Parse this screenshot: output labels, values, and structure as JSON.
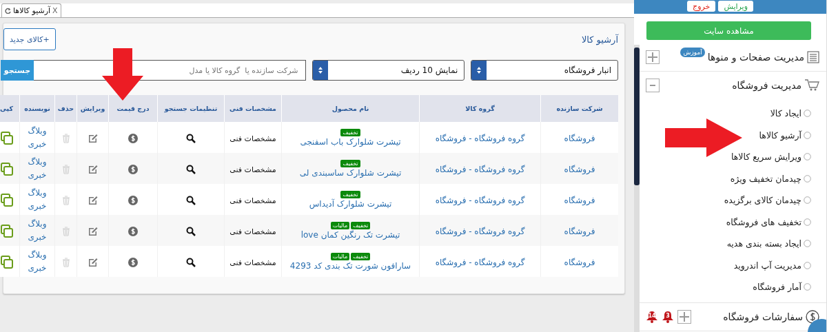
{
  "tab": {
    "title": "آرشیو کالاها",
    "close_label": "X"
  },
  "panel": {
    "title": "آرشیو کالا",
    "new_button": "+کالای جدید",
    "filters": {
      "warehouse": "انبار فروشگاه",
      "page_size": "نمایش 10 ردیف",
      "search_placeholder": "شرکت سازنده یا  گروه کالا یا مدل",
      "search_button": "جستجو"
    },
    "table": {
      "columns": [
        "شرکت سازنده",
        "گروه کالا",
        "نام محصول",
        "مشخصات فنی",
        "تنظیمات جستجو",
        "درج قیمت",
        "ویرایش",
        "حذف",
        "نویسنده",
        "کپی"
      ],
      "rows": [
        {
          "maker": "فروشگاه",
          "group": "گروه فروشگاه - فروشگاه",
          "name": "تیشرت شلوارک باب اسفنجی",
          "tags": [
            "تخفیف"
          ],
          "specs": "مشخصات فنی",
          "author": "وبلاگ خبری"
        },
        {
          "maker": "فروشگاه",
          "group": "گروه فروشگاه - فروشگاه",
          "name": "تیشرت شلوارک ساسبندی لی",
          "tags": [
            "تخفیف"
          ],
          "specs": "مشخصات فنی",
          "author": "وبلاگ خبری"
        },
        {
          "maker": "فروشگاه",
          "group": "گروه فروشگاه - فروشگاه",
          "name": "تیشرت شلوارک آدیداس",
          "tags": [
            "تخفیف"
          ],
          "specs": "مشخصات فنی",
          "author": "وبلاگ خبری"
        },
        {
          "maker": "فروشگاه",
          "group": "گروه فروشگاه - فروشگاه",
          "name": "تیشرت تک رنگین کمان love",
          "tags": [
            "تخفیف",
            "مالیات"
          ],
          "specs": "مشخصات فنی",
          "author": "وبلاگ خبری"
        },
        {
          "maker": "فروشگاه",
          "group": "گروه فروشگاه - فروشگاه",
          "name": "سارافون شورت تک بندی کد 4293",
          "tags": [
            "تخفیف",
            "مالیات"
          ],
          "specs": "مشخصات فنی",
          "author": "وبلاگ خبری"
        }
      ]
    }
  },
  "sidebar": {
    "top_buttons": [
      {
        "label": "ویرایش",
        "kind": "edit"
      },
      {
        "label": "خروج",
        "kind": "exit"
      }
    ],
    "view_site_button": "مشاهده سایت",
    "menu": [
      {
        "label": "مدیریت صفحات و منوها",
        "kind": "pages",
        "badge": "آموزش",
        "expanded": false
      },
      {
        "label": "مدیریت فروشگاه",
        "kind": "shop",
        "expanded": true,
        "children": [
          {
            "label": "ایجاد کالا"
          },
          {
            "label": "آرشیو کالاها"
          },
          {
            "label": "ویرایش سریع کالاها"
          },
          {
            "label": "چیدمان تخفیف ویژه"
          },
          {
            "label": "چیدمان کالای برگزیده"
          },
          {
            "label": "تخفیف های فروشگاه"
          },
          {
            "label": "ایجاد بسته بندی هدیه"
          },
          {
            "label": "مدیریت آپ اندروید"
          },
          {
            "label": "آمار فروشگاه"
          }
        ]
      },
      {
        "label": "سفارشات فروشگاه",
        "kind": "orders",
        "expanded": false,
        "alerts": [
          "3",
          "14"
        ]
      }
    ]
  }
}
